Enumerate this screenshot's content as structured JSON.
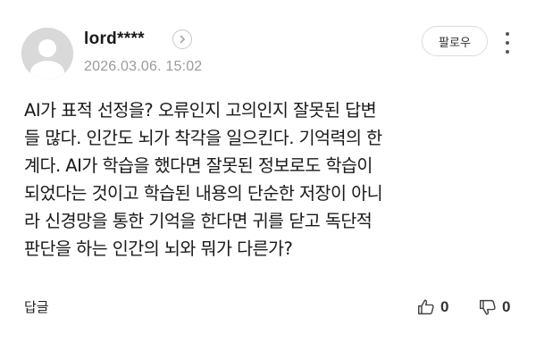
{
  "comment": {
    "username": "lord****",
    "timestamp": "2026.03.06. 15:02",
    "follow_label": "팔로우",
    "body_lines": [
      "AI가 표적 선정을? 오류인지 고의인지 잘못된 답변",
      "들 많다. 인간도 뇌가 착각을 일으킨다. 기억력의 한",
      "계다. AI가 학습을 했다면 잘못된 정보로도 학습이",
      "되었다는 것이고 학습된 내용의 단순한 저장이 아니",
      "라 신경망을 통한 기억을 한다면 귀를 닫고 독단적",
      "판단을 하는 인간의 뇌와 뭐가 다른가?"
    ],
    "reply_label": "답글",
    "likes": "0",
    "dislikes": "0"
  },
  "icons": {
    "avatar": "default-user-avatar",
    "profile_arrow": "chevron-right-icon",
    "more": "more-vertical-icon",
    "like": "thumbs-up-icon",
    "dislike": "thumbs-down-icon"
  },
  "colors": {
    "text": "#1a1a1a",
    "muted": "#9a9a9a",
    "avatar_bg": "#d9d9d9",
    "border": "#dcdcdc"
  }
}
